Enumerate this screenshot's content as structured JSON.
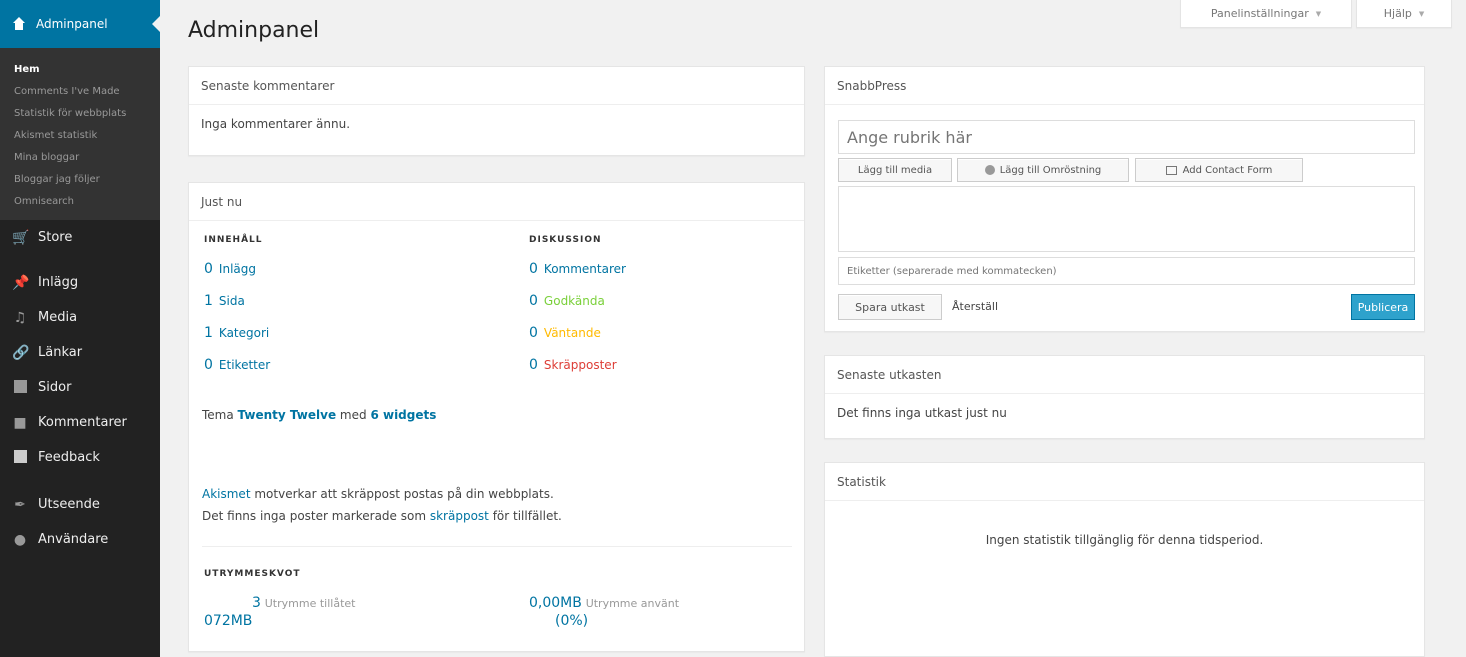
{
  "sidebar": {
    "top_label": "Adminpanel",
    "submenu": [
      "Hem",
      "Comments I've Made",
      "Statistik för webbplats",
      "Akismet statistik",
      "Mina bloggar",
      "Bloggar jag följer",
      "Omnisearch"
    ],
    "menu": [
      {
        "label": "Store",
        "icon": "cart-icon"
      },
      {
        "label": "Inlägg",
        "icon": "pin-icon"
      },
      {
        "label": "Media",
        "icon": "media-icon"
      },
      {
        "label": "Länkar",
        "icon": "link-icon"
      },
      {
        "label": "Sidor",
        "icon": "pages-icon"
      },
      {
        "label": "Kommentarer",
        "icon": "comment-icon"
      },
      {
        "label": "Feedback",
        "icon": "feedback-icon"
      },
      {
        "label": "Utseende",
        "icon": "brush-icon"
      },
      {
        "label": "Användare",
        "icon": "user-icon"
      }
    ]
  },
  "topbar": {
    "screen_options": "Panelinställningar",
    "help": "Hjälp"
  },
  "page_title": "Adminpanel",
  "recent_comments": {
    "title": "Senaste kommentarer",
    "empty": "Inga kommentarer ännu."
  },
  "right_now": {
    "title": "Just nu",
    "content_heading": "INNEHÅLL",
    "discussion_heading": "DISKUSSION",
    "content": [
      {
        "n": "0",
        "label": "Inlägg"
      },
      {
        "n": "1",
        "label": "Sida"
      },
      {
        "n": "1",
        "label": "Kategori"
      },
      {
        "n": "0",
        "label": "Etiketter"
      }
    ],
    "discussion": [
      {
        "n": "0",
        "label": "Kommentarer",
        "color": "#0074a2"
      },
      {
        "n": "0",
        "label": "Godkända",
        "color": "#7ad03a"
      },
      {
        "n": "0",
        "label": "Väntande",
        "color": "#ffba00"
      },
      {
        "n": "0",
        "label": "Skräpposter",
        "color": "#dd3d36"
      }
    ],
    "theme_prefix": "Tema",
    "theme_name": "Twenty Twelve",
    "theme_mid": "med",
    "theme_widgets": "6 widgets",
    "akismet_link": "Akismet",
    "akismet_text": "motverkar att skräppost postas på din webbplats.",
    "akismet_line2_prefix": "Det finns inga poster markerade som",
    "akismet_spam_link": "skräppost",
    "akismet_line2_suffix": "för tillfället.",
    "quota_heading": "UTRYMMESKVOT",
    "quota_allowed_value_a": "3",
    "quota_allowed_value_b": "072MB",
    "quota_allowed_label": "Utrymme tillåtet",
    "quota_used_value": "0,00MB",
    "quota_used_label": "Utrymme använt",
    "quota_used_pct": "(0%)"
  },
  "quickpress": {
    "title": "SnabbPress",
    "title_placeholder": "Ange rubrik här",
    "add_media": "Lägg till media",
    "add_poll": "Lägg till Omröstning",
    "add_contact": "Add Contact Form",
    "tags_placeholder": "Etiketter (separerade med kommatecken)",
    "save_draft": "Spara utkast",
    "reset": "Återställ",
    "publish": "Publicera"
  },
  "recent_drafts": {
    "title": "Senaste utkasten",
    "empty": "Det finns inga utkast just nu"
  },
  "stats": {
    "title": "Statistik",
    "empty": "Ingen statistik tillgänglig för denna tidsperiod."
  },
  "colors": {
    "sidebar": "#222222",
    "sidebar_active": "#0074a2",
    "link": "#0074a2",
    "primary": "#2ea2cc"
  }
}
